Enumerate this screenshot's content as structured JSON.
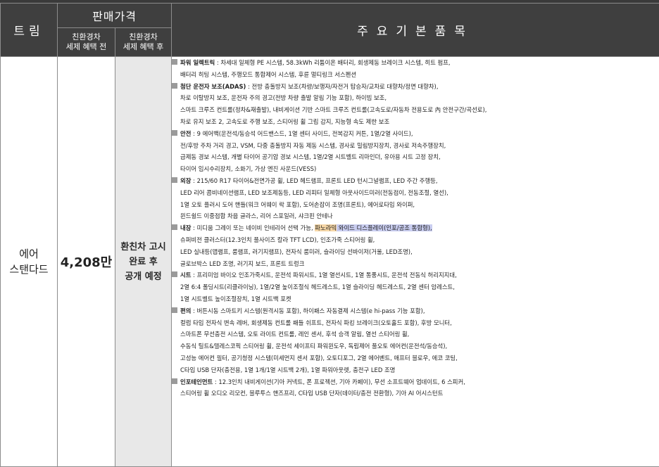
{
  "header": {
    "trim": "트림",
    "price": "판매가격",
    "price_before": [
      "친환경차",
      "세제 혜택 전"
    ],
    "price_after": [
      "친환경차",
      "세제 혜택 후"
    ],
    "main_items": "주요기본품목"
  },
  "row": {
    "trim_lines": [
      "에어",
      "스탠다드"
    ],
    "price_before": "4,208만",
    "price_after_lines": [
      "환친차 고시",
      "완료 후",
      "공개 예정"
    ]
  },
  "items": [
    {
      "title": "파워 일렉트릭",
      "lines": [
        " : 차세대 일체형 PE 시스템, 58.3kWh 리튬이온 배터리, 회생제동 브레이크 시스템, 히트 펌프,",
        "배터리 히팅 시스템, 주행모드 통합제어 시스템, 후륜 멀티링크 서스펜션"
      ]
    },
    {
      "title": "첨단 운전자 보조(ADAS)",
      "lines": [
        " : 전방 충돌방지 보조(차량/보행자/자전거 탑승자/교차로 대향차/정면 대향차),",
        "차로 이탈방지 보조, 운전자 주의 경고(전방 차량 출발 알림 기능 포함), 하이빔 보조,",
        "스마트 크루즈 컨트롤(정차&재출발), 내비게이션 기반 스마트 크루즈 컨트롤(고속도로/자동차 전용도로 內 안전구간/곡선로),",
        "차로 유지 보조 2, 고속도로 주행 보조, 스티어링 휠 그립 감지, 지능형 속도 제한 보조"
      ]
    },
    {
      "title": "안전",
      "lines": [
        " : 9 에어백(운전석/동승석 어드밴스드, 1열 센터 사이드, 전복감지 커튼, 1열/2열 사이드),",
        "전/후방 주차 거리 경고, VSM, 다중 충돌방지 자동 제동 시스템, 경사로 밀림방지장치, 경사로 저속주행장치,",
        "급제동 경보 시스템, 개별 타이어 공기압 경보 시스템, 1열/2열 시트벨트 리마인더, 유아용 시트 고정 장치,",
        "타이어 임시수리장치, 소화기, 가상 엔진 사운드(VESS)"
      ]
    },
    {
      "title": "외장",
      "lines": [
        " : 215/60 R17 타이어&전면가공 휠, LED 헤드램프, 프론트 LED 턴시그널램프, LED 주간 주행등,",
        "LED 리어 콤비네이션램프, LED 보조제동등, LED 리피터 일체형 아웃사이드미러(전동접이, 전동조절, 열선),",
        "1열 오토 플러시 도어 핸들(워크 어웨이 락 포함), 도어손잡이 조명(프론트), 에어로타입 와이퍼,",
        "윈드쉴드 이중접합 차음 글라스, 리어 스포일러, 샤크핀 안테나"
      ]
    },
    {
      "title": "내장",
      "first_plain": " : 미디움 그레이 또는 네이비 인테리어 선택 가능, ",
      "first_orange": "파노라믹",
      "first_blue": " 와이드 디스플레이(인포/공조 통합형),",
      "lines": [
        "슈퍼비전 클러스터(12.3인치 풀사이즈 칼라 TFT LCD), 인조가죽 스티어링 휠,",
        "LED 실내등(맵램프, 룸램프, 러기지램프), 전자식 룸미러, 슬라이딩 선바이저(거울, LED조명),",
        "글로브박스 LED 조명, 러기지 보드, 프론트 트렁크"
      ]
    },
    {
      "title": "시트",
      "lines": [
        " : 프리미엄 바이오 인조가죽시트, 운전석 파워시트, 1열 열선시트, 1열 통풍시트, 운전석 전동식 허리지지대,",
        "2열 6:4 폴딩시트(리클라이닝), 1열/2열 높이조절식 헤드레스트, 1열 슬라이딩 헤드레스트, 2열 센터 암레스트,",
        "1열 시트벨트 높이조절장치, 1열 시트백 포켓"
      ]
    },
    {
      "title": "편의",
      "lines": [
        " : 버튼시동 스마트키 시스템(원격시동 포함), 하이패스 자동결제 시스템(e hi-pass 기능 포함),",
        "컬럼 타입 전자식 변속 레버, 회생제동 컨트롤 패들 쉬프트, 전자식 파킹 브레이크(오토홀드 포함), 후방 모니터,",
        "스마트폰 무선충전 시스템, 오토 라이트 컨트롤, 레인 센서, 후석 승객 알림, 열선 스티어링 휠,",
        "수동식 틸트&텔레스코픽 스티어링 휠, 운전석 세이프티 파워윈도우, 독립제어 풀오토 에어컨(운전석/동승석),",
        "고성능 에어컨 필터, 공기청정 시스템(미세먼지 센서 포함), 오토디포그, 2열 에어벤트, 애프터 블로우, 에코 코팅,",
        "C타입 USB 단자(충전용, 1열 1개/1열 시트백 2개), 1열 파워아웃렛, 충전구 LED 조명"
      ]
    },
    {
      "title": "인포테인먼트",
      "lines": [
        " : 12.3인치 내비게이션(기아 커넥트, 폰 프로젝션, 기아 카페이), 무선 소프트웨어 업데이트, 6 스피커,",
        "스티어링 휠 오디오 리모컨, 블루투스 핸즈프리, C타입 USB 단자(데이터/충전 전환형), 기아 AI 어시스턴트"
      ]
    }
  ],
  "colors": {
    "header_bg": "#3f3f3f",
    "price_after_bg": "#e8e8e8",
    "highlight_orange": "#f5d6a6",
    "highlight_blue": "#c9cdf0"
  }
}
